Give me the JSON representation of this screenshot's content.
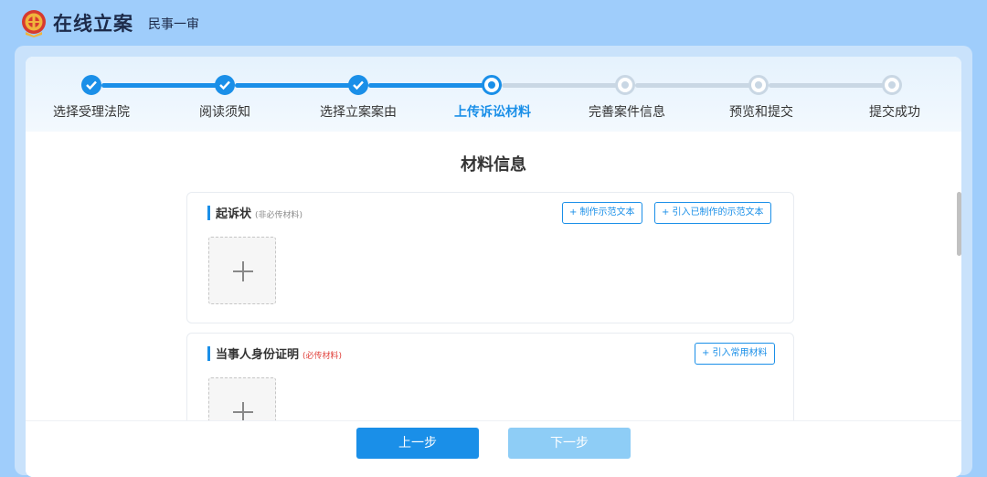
{
  "header": {
    "title": "在线立案",
    "subtitle": "民事一审"
  },
  "steps": [
    {
      "label": "选择受理法院",
      "state": "done"
    },
    {
      "label": "阅读须知",
      "state": "done"
    },
    {
      "label": "选择立案案由",
      "state": "done"
    },
    {
      "label": "上传诉讼材料",
      "state": "current"
    },
    {
      "label": "完善案件信息",
      "state": "todo"
    },
    {
      "label": "预览和提交",
      "state": "todo"
    },
    {
      "label": "提交成功",
      "state": "todo"
    }
  ],
  "main": {
    "section_title": "材料信息",
    "panels": [
      {
        "name": "起诉状",
        "note": "(非必传材料)",
        "buttons": [
          "+ 制作示范文本",
          "+ 引入已制作的示范文本"
        ]
      },
      {
        "name": "当事人身份证明",
        "note": "(必传材料)",
        "buttons": [
          "+ 引入常用材料"
        ]
      }
    ]
  },
  "footer": {
    "prev_label": "上一步",
    "next_label": "下一步"
  },
  "colors": {
    "accent": "#1a8fe8",
    "background": "#9fcdfb",
    "required": "#e0403a"
  }
}
